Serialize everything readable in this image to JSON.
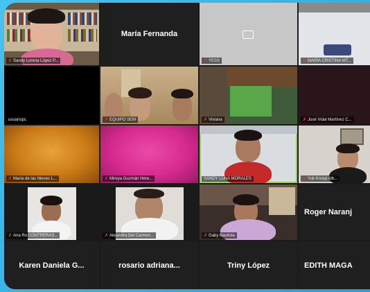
{
  "tiles": [
    {
      "name": "Sandy Lorena López P..."
    },
    {
      "name": "María Fernanda"
    },
    {
      "name": "YESS"
    },
    {
      "name": "MARÍA CRISTINA MT..."
    },
    {
      "name": "usuariopc"
    },
    {
      "name": "EQUIPO SEM"
    },
    {
      "name": "Viviana"
    },
    {
      "name": "José Vidal Martínez C..."
    },
    {
      "name": "María de las Nieves L..."
    },
    {
      "name": "Mireya Guzmán Here..."
    },
    {
      "name": "SANDY LUNA MORALES"
    },
    {
      "name": "Yuli Kristal Alb..."
    },
    {
      "name": "Ana Ro CONTRERAS..."
    },
    {
      "name": "Alejandra Del Carmen..."
    },
    {
      "name": "Gaby Bautista"
    },
    {
      "name": "Roger Naranj"
    },
    {
      "name": "Karen Daniela G..."
    },
    {
      "name": "rosario adriana..."
    },
    {
      "name": "Triny López"
    },
    {
      "name": "EDITH MAGA"
    }
  ],
  "colors": {
    "active_border": "#8fd14f",
    "muted_mic": "#e23b3b",
    "orange": "#d4871a",
    "magenta": "#d62a8f"
  },
  "icons": {
    "muted": "muted-mic-icon",
    "screen_share": "screen-share-icon"
  }
}
